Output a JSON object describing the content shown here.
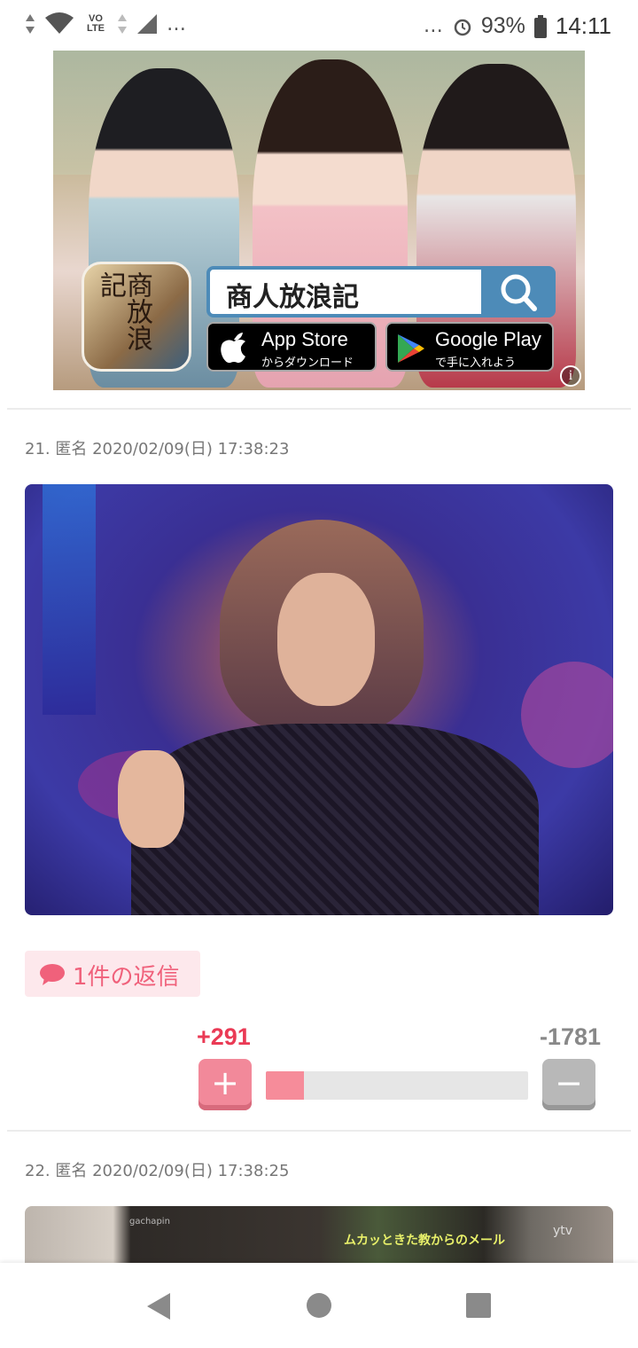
{
  "status_bar": {
    "left_dots": "…",
    "volte_label": "VO LTE",
    "right_dots": "…",
    "battery": "93%",
    "time": "14:11"
  },
  "ad": {
    "app_icon_text": "商放浪記",
    "search_text": "商人放浪記",
    "app_store": {
      "main": "App Store",
      "sub": "からダウンロード"
    },
    "google_play": {
      "main": "Google Play",
      "sub": "で手に入れよう"
    },
    "info_icon": "i"
  },
  "comments": [
    {
      "header": "21. 匿名 2020/02/09(日) 17:38:23",
      "reply_label": "1件の返信",
      "plus_count": "+291",
      "minus_count": "-1781",
      "plus_symbol": "+",
      "minus_symbol": "−",
      "vote_ratio": 0.145
    },
    {
      "header": "22. 匿名 2020/02/09(日) 17:38:25",
      "photo_url_text": "gachapin",
      "photo_caption": "ムカッときた教からのメール",
      "photo_logo": "ytv"
    }
  ],
  "colors": {
    "accent_pink": "#ea3a55",
    "reply_pink": "#f0617b",
    "reply_bg": "#fde8ec",
    "ad_blue": "#4d8bb8"
  }
}
